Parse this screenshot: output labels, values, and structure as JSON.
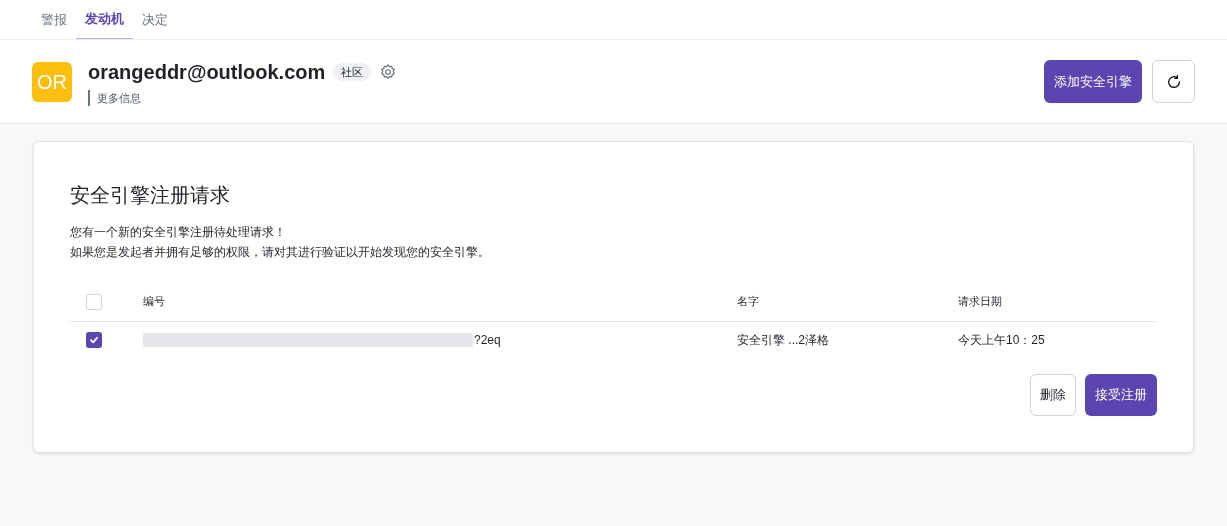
{
  "tabs": [
    {
      "label": "警报",
      "selected": false
    },
    {
      "label": "发动机",
      "selected": true
    },
    {
      "label": "决定",
      "selected": false
    }
  ],
  "header": {
    "avatar": "OR",
    "title": "orangeddr@outlook.com",
    "badge": "社区",
    "subtitle": "更多信息",
    "primary_button": "添加安全引擎"
  },
  "card": {
    "title": "安全引擎注册请求",
    "lines": [
      "您有一个新的安全引擎注册待处理请求！",
      "如果您是发起者并拥有足够的权限，请对其进行验证以开始发现您的安全引擎。"
    ],
    "table": {
      "select_all": {
        "checked": false
      },
      "columns": [
        "编号",
        "名字",
        "请求日期"
      ],
      "rows": [
        {
          "checked": true,
          "id_visible": "?2eq",
          "name": "安全引擎 ...2泽格",
          "date": "今天上午10：25"
        }
      ]
    },
    "buttons": [
      {
        "label": "删除",
        "kind": "secondary"
      },
      {
        "label": "接受注册",
        "kind": "primary"
      }
    ]
  }
}
